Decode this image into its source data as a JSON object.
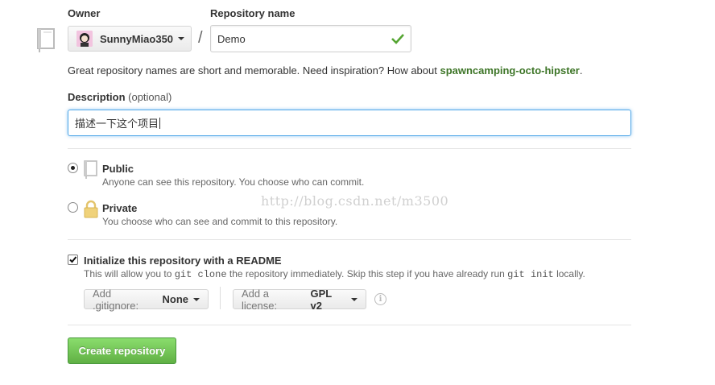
{
  "owner": {
    "label": "Owner",
    "selected": "SunnyMiao350"
  },
  "separator": "/",
  "repo_name": {
    "label": "Repository name",
    "value": "Demo"
  },
  "hint": {
    "text": "Great repository names are short and memorable. Need inspiration? How about ",
    "suggestion": "spawncamping-octo-hipster",
    "end": "."
  },
  "description": {
    "label": "Description",
    "optional": "(optional)",
    "value": "描述一下这个项目"
  },
  "visibility": {
    "public": {
      "title": "Public",
      "desc": "Anyone can see this repository. You choose who can commit.",
      "checked": true
    },
    "private": {
      "title": "Private",
      "desc": "You choose who can see and commit to this repository.",
      "checked": false
    }
  },
  "watermark": "http://blog.csdn.net/m3500",
  "readme": {
    "title": "Initialize this repository with a README",
    "desc_before": "This will allow you to ",
    "code1": "git clone",
    "desc_middle": " the repository immediately. Skip this step if you have already run ",
    "code2": "git init",
    "desc_after": " locally.",
    "checked": true
  },
  "gitignore": {
    "prefix": "Add .gitignore:",
    "value": "None"
  },
  "license": {
    "prefix": "Add a license:",
    "value": "GPL v2"
  },
  "info_glyph": "i",
  "create_button": "Create repository",
  "colors": {
    "suggestion": "#3d7527",
    "button_green": "#60b044",
    "focus_blue": "#51a7e8"
  }
}
